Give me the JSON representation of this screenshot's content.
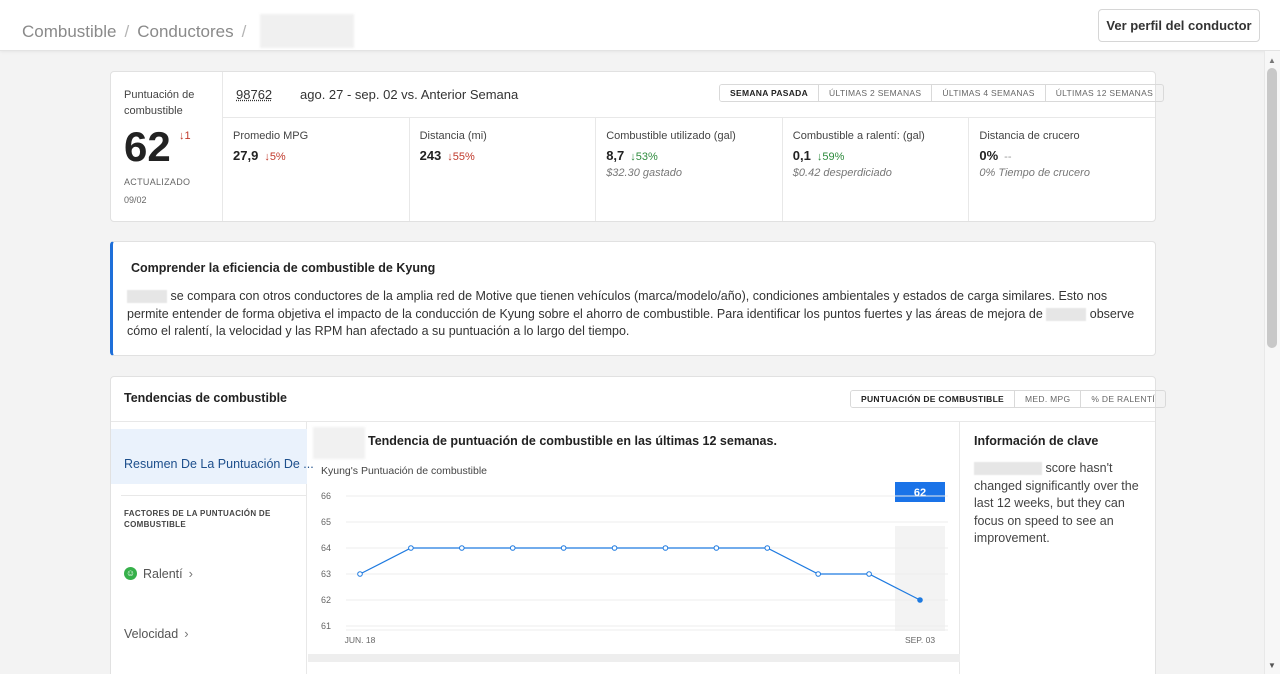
{
  "header": {
    "breadcrumb": [
      "Combustible",
      "Conductores"
    ],
    "profile_button": "Ver perfil del conductor"
  },
  "score_card": {
    "label": "Puntuación de combustible",
    "score": "62",
    "delta": "↓1",
    "updated_label": "ACTUALIZADO",
    "updated_date": "09/02",
    "id": "98762",
    "range": "ago. 27 - sep. 02 vs. Anterior Semana",
    "periods": [
      "SEMANA PASADA",
      "ÚLTIMAS 2 SEMANAS",
      "ÚLTIMAS 4 SEMANAS",
      "ÚLTIMAS 12 SEMANAS"
    ],
    "active_period": 0,
    "metrics": [
      {
        "label": "Promedio MPG",
        "value": "27,9",
        "change": "↓5%",
        "dir": "down",
        "sub": ""
      },
      {
        "label": "Distancia (mi)",
        "value": "243",
        "change": "↓55%",
        "dir": "down",
        "sub": ""
      },
      {
        "label": "Combustible utilizado (gal)",
        "value": "8,7",
        "change": "↓53%",
        "dir": "up",
        "sub": "$32.30 gastado"
      },
      {
        "label": "Combustible a ralentí: (gal)",
        "value": "0,1",
        "change": "↓59%",
        "dir": "up",
        "sub": "$0.42 desperdiciado"
      },
      {
        "label": "Distancia de crucero",
        "value": "0%",
        "change": "--",
        "dir": "flat",
        "sub": "0% Tiempo de crucero"
      }
    ]
  },
  "info": {
    "title": "Comprender la eficiencia de combustible de Kyung",
    "body_1": "se compara con otros conductores de la amplia red de Motive que tienen vehículos (marca/modelo/año), condiciones ambientales y estados de carga similares. Esto nos permite entender de forma objetiva el impacto de la conducción de Kyung sobre el ahorro de combustible. Para identificar los puntos fuertes y las áreas de mejora de",
    "body_2": "observe cómo el ralentí, la velocidad y las RPM han afectado a su puntuación a lo largo del tiempo."
  },
  "trends": {
    "title": "Tendencias de combustible",
    "tabs": [
      "PUNTUACIÓN DE COMBUSTIBLE",
      "MED. MPG",
      "% DE RALENTÍ"
    ],
    "active_tab": 0,
    "nav": {
      "active": "Resumen De La Puntuación De ...",
      "heading": "FACTORES DE LA PUNTUACIÓN DE COMBUSTIBLE",
      "items": [
        "Ralentí",
        "Velocidad"
      ]
    },
    "key_info": {
      "title": "Información de clave",
      "text": "score hasn't changed significantly over the last 12 weeks, but they can focus on speed to see an improvement."
    }
  },
  "chart_data": {
    "type": "line",
    "title": "Tendencia de puntuación de combustible en las últimas 12 semanas.",
    "subtitle": "Kyung's Puntuación de combustible",
    "x_first_label": "JUN. 18",
    "x_last_label": "SEP. 03",
    "y_ticks": [
      66,
      65,
      64,
      63,
      62,
      61
    ],
    "ylim": [
      61,
      66
    ],
    "values": [
      63,
      64,
      64,
      64,
      64,
      64,
      64,
      64,
      64,
      63,
      63,
      62
    ],
    "highlight_label": "62",
    "colors": {
      "line": "#1e7ae0",
      "highlight": "#1a73e8"
    },
    "grid": true
  }
}
